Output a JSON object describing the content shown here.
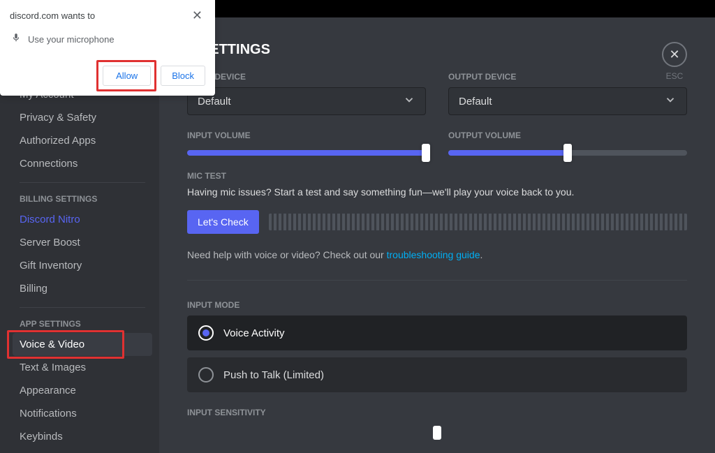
{
  "perm": {
    "title_text": "discord.com wants to",
    "mic_line": "Use your microphone",
    "allow": "Allow",
    "block": "Block"
  },
  "sidebar": {
    "user_settings": [
      "My Account",
      "Privacy & Safety",
      "Authorized Apps",
      "Connections"
    ],
    "billing_title": "BILLING SETTINGS",
    "billing": [
      "Discord Nitro",
      "Server Boost",
      "Gift Inventory",
      "Billing"
    ],
    "app_title": "APP SETTINGS",
    "app": [
      "Voice & Video",
      "Text & Images",
      "Appearance",
      "Notifications",
      "Keybinds"
    ]
  },
  "main": {
    "title": "E SETTINGS",
    "esc_label": "ESC",
    "input_device_label": "INPUT DEVICE",
    "output_device_label": "OUTPUT DEVICE",
    "device_default": "Default",
    "input_volume_label": "INPUT VOLUME",
    "output_volume_label": "OUTPUT VOLUME",
    "input_volume_pct": 100,
    "output_volume_pct": 50,
    "mic_test_label": "MIC TEST",
    "mic_test_help": "Having mic issues? Start a test and say something fun—we'll play your voice back to you.",
    "lets_check": "Let's Check",
    "help_prefix": "Need help with voice or video? Check out our ",
    "help_link": "troubleshooting guide",
    "input_mode_label": "INPUT MODE",
    "mode_voice_activity": "Voice Activity",
    "mode_ptt": "Push to Talk (Limited)",
    "input_sensitivity_label": "INPUT SENSITIVITY"
  }
}
